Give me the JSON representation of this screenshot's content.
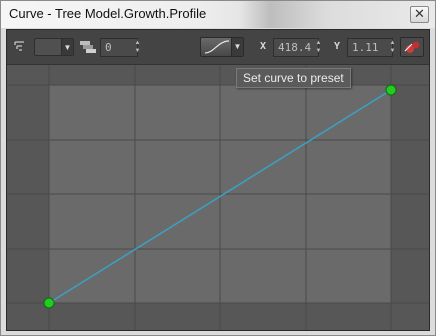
{
  "window": {
    "title": "Curve - Tree Model.Growth.Profile",
    "close_glyph": "✕"
  },
  "toolbar": {
    "layer_value": "0",
    "x_label": "X",
    "x_value": "418.4",
    "y_label": "Y",
    "y_value": "1.11"
  },
  "tooltip": {
    "text": "Set curve to preset"
  },
  "colors": {
    "curve": "#3c9fc0",
    "key": "#22cc22",
    "graph_bg": "#575757",
    "range_bg": "#6a6a6a",
    "grid": "#4a4a4a"
  },
  "icons": [
    "filter-icon",
    "layers-icon",
    "curve-preset-icon",
    "reset-icon"
  ]
}
